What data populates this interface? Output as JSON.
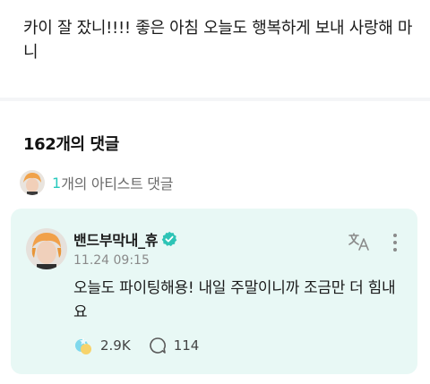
{
  "post": {
    "text": "카이 잘 잤니!!!! 좋은 아침 오늘도 행복하게 보내 사랑해 마니"
  },
  "comments": {
    "count_label": "162개의 댓글",
    "artist_count": "1",
    "artist_label": "개의 아티스트 댓글"
  },
  "artist_comment": {
    "author": "밴드부막내_휴",
    "time": "11.24 09:15",
    "text": "오늘도 파이팅해용! 내일 주말이니까 조금만 더 힘내요",
    "cheer_count": "2.9K",
    "reply_count": "114"
  },
  "icons": {
    "verified": "verified-check-icon",
    "translate": "translate-icon",
    "more": "more-vertical-icon",
    "cheer": "cheer-icon",
    "reply": "comment-bubble-icon"
  },
  "colors": {
    "accent": "#29c9bd",
    "card_background": "#e8f8f5"
  }
}
